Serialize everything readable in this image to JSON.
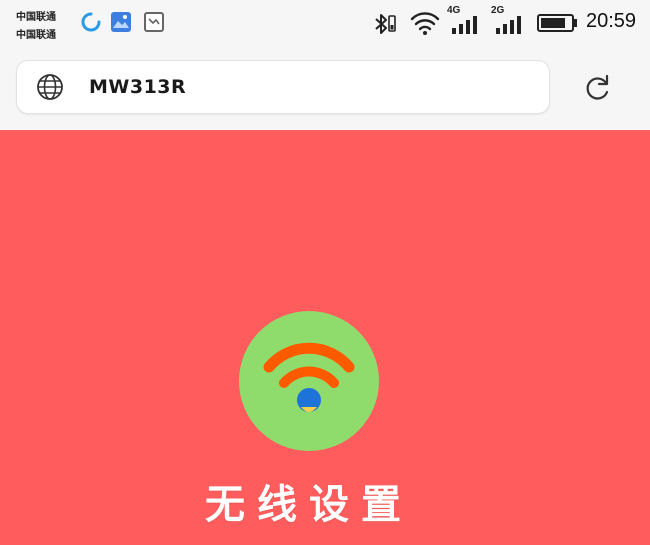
{
  "status_bar": {
    "carrier_1": "中国联通",
    "carrier_2": "中国联通",
    "network_4g": "4G",
    "network_2g": "2G",
    "time": "20:59",
    "icons": [
      "loading-icon",
      "gallery-icon",
      "image-icon",
      "bluetooth-icon",
      "wifi-signal-icon",
      "cell-signal-4g-icon",
      "cell-signal-2g-icon",
      "battery-icon"
    ]
  },
  "browser": {
    "url": "MW313R",
    "icons": [
      "globe-icon",
      "reload-icon"
    ]
  },
  "main": {
    "heading": "无线设置",
    "logo_icon": "wifi-logo-icon"
  },
  "colors": {
    "background": "#ff5d5d",
    "logo_circle": "#8fdc6c",
    "wifi_arcs": "#ff5a00",
    "wifi_dot": "#1e73d8",
    "bar_background": "#f6f6f6"
  }
}
